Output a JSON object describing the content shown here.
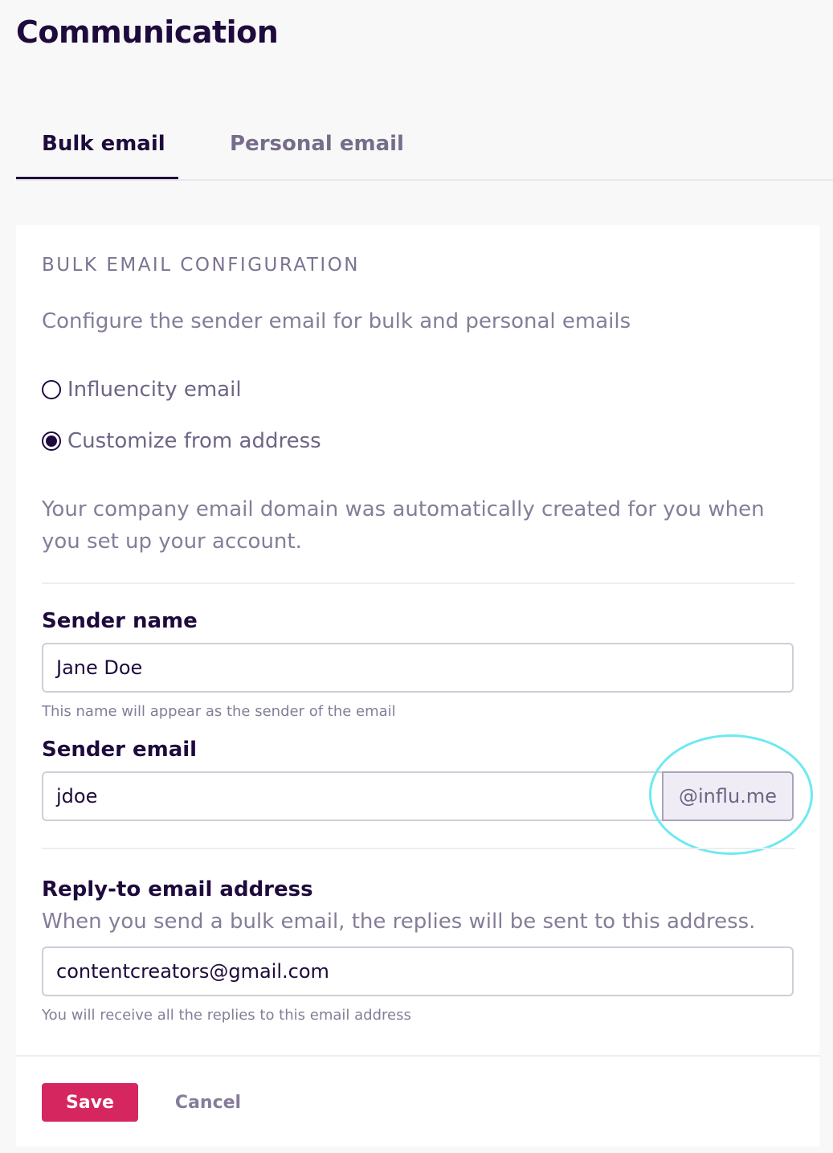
{
  "page": {
    "title": "Communication"
  },
  "tabs": [
    {
      "label": "Bulk email",
      "active": true
    },
    {
      "label": "Personal email",
      "active": false
    }
  ],
  "section": {
    "heading": "BULK EMAIL CONFIGURATION",
    "description": "Configure the sender email for bulk and personal emails"
  },
  "sender_options": [
    {
      "label": "Influencity email",
      "selected": false
    },
    {
      "label": "Customize from address",
      "selected": true
    }
  ],
  "info_text": "Your company email domain was automatically created for you when you set up your account.",
  "sender_name": {
    "label": "Sender name",
    "value": "Jane Doe",
    "helper": "This name will appear as the sender of the email"
  },
  "sender_email": {
    "label": "Sender email",
    "value": "jdoe",
    "domain_suffix": "@influ.me"
  },
  "reply_to": {
    "label": "Reply-to email address",
    "description": "When you send a bulk email, the replies will be sent to this address.",
    "value": "contentcreators@gmail.com",
    "helper": "You will receive all the replies to this email address"
  },
  "actions": {
    "save_label": "Save",
    "cancel_label": "Cancel"
  },
  "colors": {
    "primary_text": "#1e0a3c",
    "muted_text": "#857d98",
    "save_button": "#d6265f",
    "highlight_ring": "#6ee9f2",
    "suffix_background": "#efecf5"
  }
}
